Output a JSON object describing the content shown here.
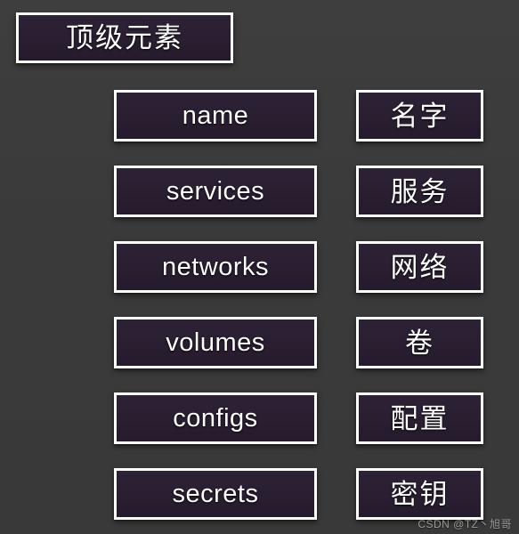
{
  "diagram": {
    "title_node": {
      "label": "顶级元素"
    },
    "rows": [
      {
        "key": "name",
        "gloss": "名字"
      },
      {
        "key": "services",
        "gloss": "服务"
      },
      {
        "key": "networks",
        "gloss": "网络"
      },
      {
        "key": "volumes",
        "gloss": "卷"
      },
      {
        "key": "configs",
        "gloss": "配置"
      },
      {
        "key": "secrets",
        "gloss": "密钥"
      }
    ]
  },
  "watermark": {
    "text": "CSDN @TZ丶旭哥"
  },
  "colors": {
    "background": "#3a3a3a",
    "node_fill": "#2a1e31",
    "node_border": "#ffffff",
    "text": "#ffffff",
    "watermark_text": "#9a9a9a"
  }
}
